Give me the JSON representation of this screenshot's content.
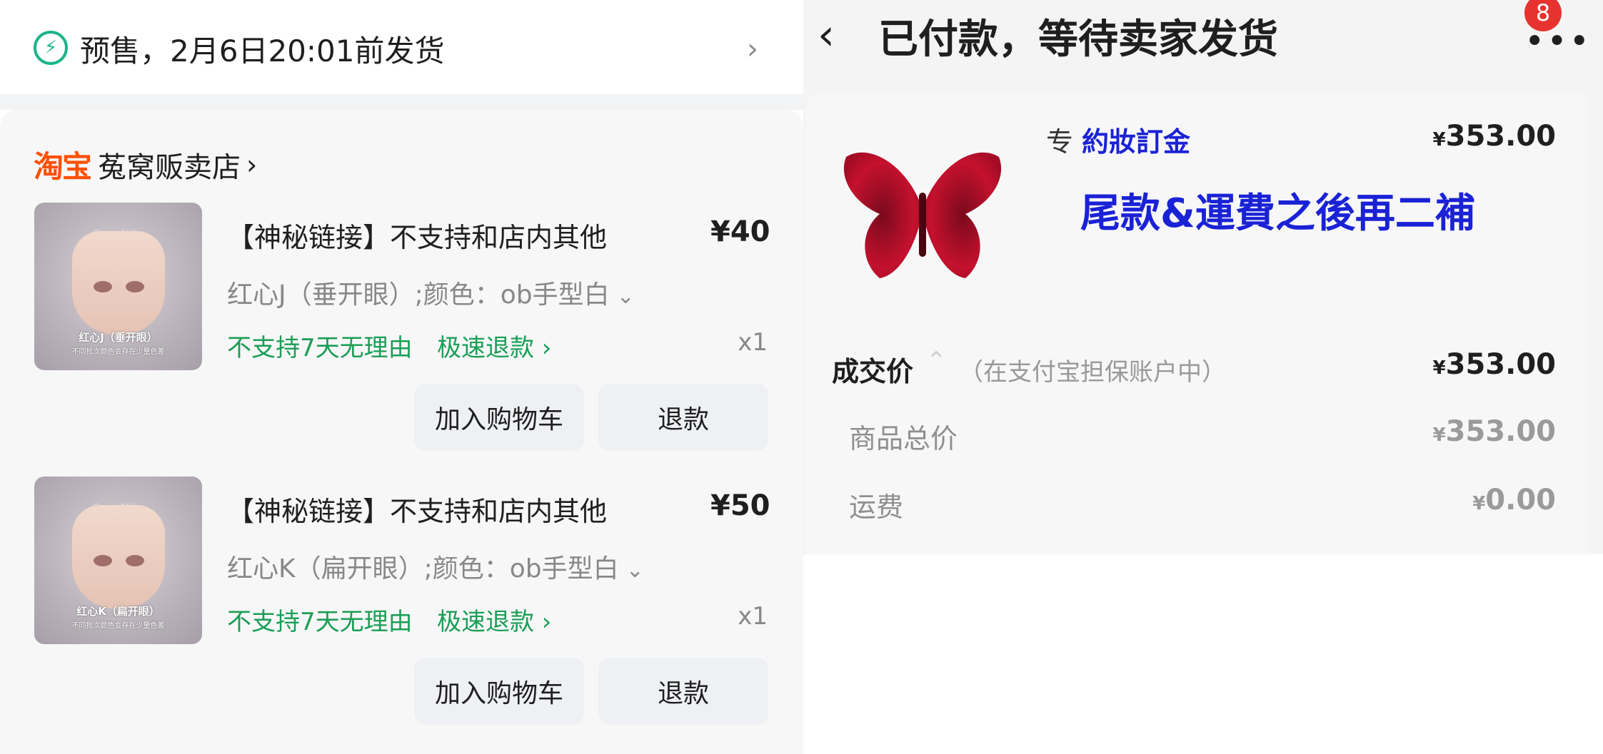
{
  "left": {
    "presale": {
      "text": "预售，2月6日20:01前发货",
      "icon": "lightning-icon"
    },
    "shop": {
      "platform": "淘宝",
      "name": "菟窝贩卖店"
    },
    "items": [
      {
        "title": "【神秘链接】不支持和店内其他",
        "price": "¥40",
        "spec": "红心J（垂开眼）;颜色：ob手型白",
        "tag_return": "不支持7天无理由",
        "tag_refund": "极速退款",
        "qty": "x1",
        "thumb_caption": "红心J（垂开眼）",
        "thumb_sub": "不同批次颜色会存在少量色差",
        "btn_cart": "加入购物车",
        "btn_refund": "退款"
      },
      {
        "title": "【神秘链接】不支持和店内其他",
        "price": "¥50",
        "spec": "红心K（扁开眼）;颜色：ob手型白",
        "tag_return": "不支持7天无理由",
        "tag_refund": "极速退款",
        "qty": "x1",
        "thumb_caption": "红心K（扁开眼）",
        "thumb_sub": "不同批次颜色会存在少量色差",
        "btn_cart": "加入购物车",
        "btn_refund": "退款"
      }
    ]
  },
  "right": {
    "status_title": "已付款，等待卖家发货",
    "badge_count": "8",
    "product": {
      "prefix": "专",
      "name": "約妝訂金",
      "price": "353.00",
      "note": "尾款&運費之後再二補"
    },
    "summary": {
      "deal_label": "成交价",
      "deal_note": "（在支付宝担保账户中）",
      "deal_value": "353.00",
      "goods_label": "商品总价",
      "goods_value": "353.00",
      "shipping_label": "运费",
      "shipping_value": "0.00"
    }
  },
  "colors": {
    "accent_green": "#1a9e55",
    "taobao_orange": "#ff5000",
    "note_blue": "#1a22d6",
    "badge_red": "#e7332f"
  }
}
